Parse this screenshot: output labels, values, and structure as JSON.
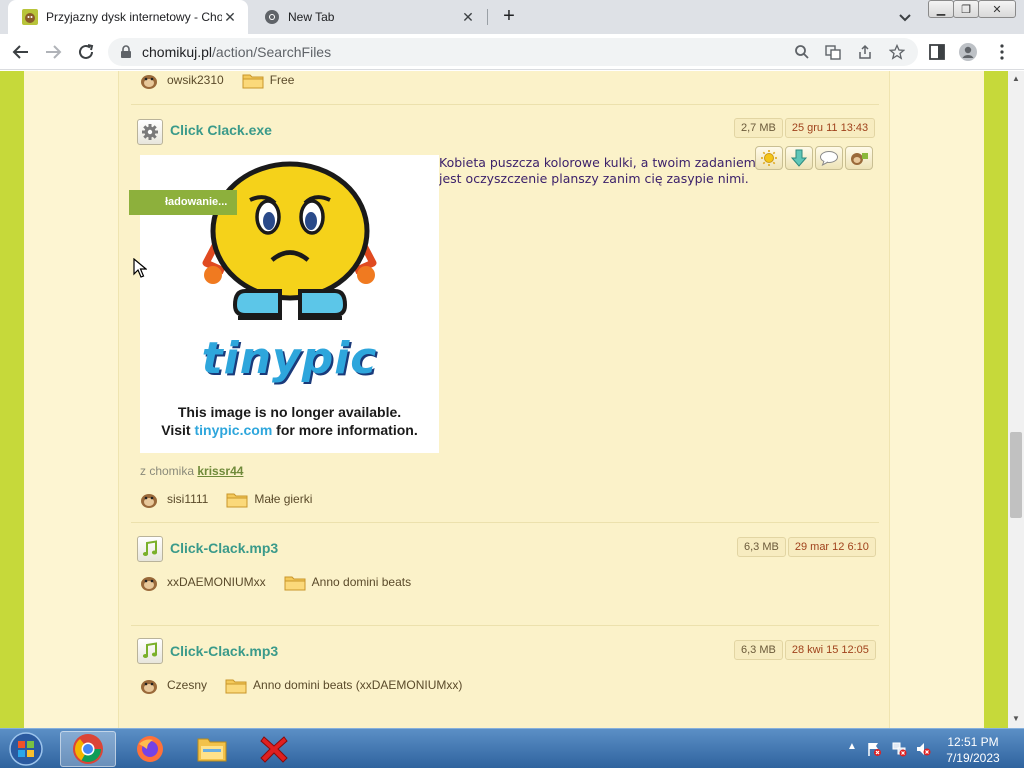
{
  "browser": {
    "tabs": [
      {
        "title": "Przyjazny dysk internetowy - Chomikuj.pl",
        "active": true
      },
      {
        "title": "New Tab",
        "active": false
      }
    ],
    "url_host": "chomikuj.pl",
    "url_path": "/action/SearchFiles"
  },
  "page": {
    "top_row": {
      "owner": "owsik2310",
      "folder": "Free"
    },
    "results": [
      {
        "name": "Click Clack.exe",
        "size": "2,7 MB",
        "date": "25 gru 11 13:43",
        "icon": "gear-icon",
        "description": "Kobieta puszcza kolorowe kulki, a twoim zadaniem jest oczyszczenie planszy zanim cię zasypie nimi.",
        "loading_label": "ładowanie...",
        "image_text_1": "This image is no longer available.",
        "image_text_2_a": "Visit ",
        "image_text_2_link": "tinypic.com",
        "image_text_2_b": " for more information.",
        "image_logo": "tinypic",
        "from_label": "z chomika",
        "from_user": "krissr44",
        "owner": "sisi1111",
        "folder": "Małe gierki"
      },
      {
        "name": "Click-Clack.mp3",
        "size": "6,3 MB",
        "date": "29 mar 12 6:10",
        "icon": "music-note-icon",
        "owner": "xxDAEMONIUMxx",
        "folder": "Anno domini beats"
      },
      {
        "name": "Click-Clack.mp3",
        "size": "6,3 MB",
        "date": "28 kwi 15 12:05",
        "icon": "music-note-icon",
        "owner": "Czesny",
        "folder": "Anno domini beats (xxDAEMONIUMxx)"
      }
    ]
  },
  "taskbar": {
    "time": "12:51 PM",
    "date": "7/19/2023"
  },
  "colors": {
    "accent_green": "#c8dc3c",
    "file_link": "#3a9a8a",
    "date_text": "#a0421c",
    "content_bg": "#fbf2c9"
  }
}
